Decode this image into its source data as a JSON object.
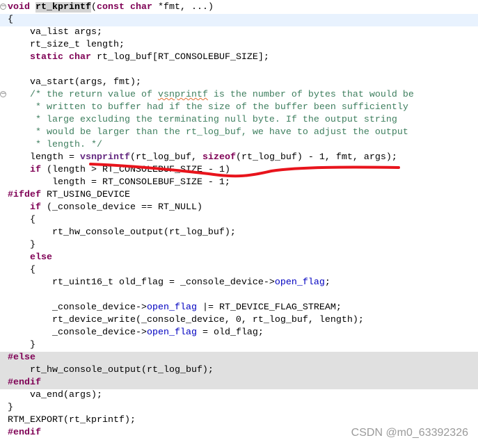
{
  "editor": {
    "current_line": 1,
    "inactive_lines": [
      28,
      29,
      30
    ],
    "fold_lines": [
      0,
      7
    ],
    "lines": [
      [
        [
          "void ",
          "kw"
        ],
        [
          "rt_kprintf",
          "sel"
        ],
        [
          "(",
          ""
        ],
        [
          "const char ",
          "kw"
        ],
        [
          "*fmt, ...)",
          ""
        ]
      ],
      [
        [
          "{",
          ""
        ]
      ],
      [
        [
          "    va_list args;",
          ""
        ]
      ],
      [
        [
          "    rt_size_t length;",
          ""
        ]
      ],
      [
        [
          "    ",
          ""
        ],
        [
          "static char ",
          "kw"
        ],
        [
          "rt_log_buf[RT_CONSOLEBUF_SIZE];",
          ""
        ]
      ],
      [],
      [
        [
          "    va_start(args, fmt);",
          ""
        ]
      ],
      [
        [
          "    /* the return value of ",
          "cm"
        ],
        [
          "vsnprintf",
          "cm squig"
        ],
        [
          " is the number of bytes that would be",
          "cm"
        ]
      ],
      [
        [
          "     * written to buffer had if the size of the buffer been sufficiently",
          "cm"
        ]
      ],
      [
        [
          "     * large excluding the terminating null byte. If the output string",
          "cm"
        ]
      ],
      [
        [
          "     * would be larger than the rt_log_buf, we have to adjust the output",
          "cm"
        ]
      ],
      [
        [
          "     * length. */",
          "cm"
        ]
      ],
      [
        [
          "    length = ",
          ""
        ],
        [
          "vsnprintf",
          "fn"
        ],
        [
          "(rt_log_buf, ",
          ""
        ],
        [
          "sizeof",
          "kw"
        ],
        [
          "(rt_log_buf) - 1, fmt, args);",
          ""
        ]
      ],
      [
        [
          "    ",
          ""
        ],
        [
          "if ",
          "kw"
        ],
        [
          "(length > RT_CONSOLEBUF_SIZE - 1)",
          ""
        ]
      ],
      [
        [
          "        length = RT_CONSOLEBUF_SIZE - 1;",
          ""
        ]
      ],
      [
        [
          "#ifdef ",
          "kw"
        ],
        [
          "RT_USING_DEVICE",
          ""
        ]
      ],
      [
        [
          "    ",
          ""
        ],
        [
          "if ",
          "kw"
        ],
        [
          "(_console_device == RT_NULL)",
          ""
        ]
      ],
      [
        [
          "    {",
          ""
        ]
      ],
      [
        [
          "        rt_hw_console_output(rt_log_buf);",
          ""
        ]
      ],
      [
        [
          "    }",
          ""
        ]
      ],
      [
        [
          "    ",
          ""
        ],
        [
          "else",
          "kw"
        ]
      ],
      [
        [
          "    {",
          ""
        ]
      ],
      [
        [
          "        rt_uint16_t old_flag = _console_device->",
          ""
        ],
        [
          "open_flag",
          "fld"
        ],
        [
          ";",
          ""
        ]
      ],
      [],
      [
        [
          "        _console_device->",
          ""
        ],
        [
          "open_flag",
          "fld"
        ],
        [
          " |= RT_DEVICE_FLAG_STREAM;",
          ""
        ]
      ],
      [
        [
          "        rt_device_write(_console_device, 0, rt_log_buf, length);",
          ""
        ]
      ],
      [
        [
          "        _console_device->",
          ""
        ],
        [
          "open_flag",
          "fld"
        ],
        [
          " = old_flag;",
          ""
        ]
      ],
      [
        [
          "    }",
          ""
        ]
      ],
      [
        [
          "#else",
          "kw"
        ]
      ],
      [
        [
          "    rt_hw_console_output(rt_log_buf);",
          ""
        ]
      ],
      [
        [
          "#endif",
          "kw"
        ]
      ],
      [
        [
          "    va_end(args);",
          ""
        ]
      ],
      [
        [
          "}",
          ""
        ]
      ],
      [
        [
          "RTM_EXPORT(rt_kprintf);",
          ""
        ]
      ],
      [
        [
          "#endif",
          "kw"
        ]
      ]
    ]
  },
  "annotation": {
    "color": "#e8141c"
  },
  "watermark": "CSDN @m0_63392326"
}
